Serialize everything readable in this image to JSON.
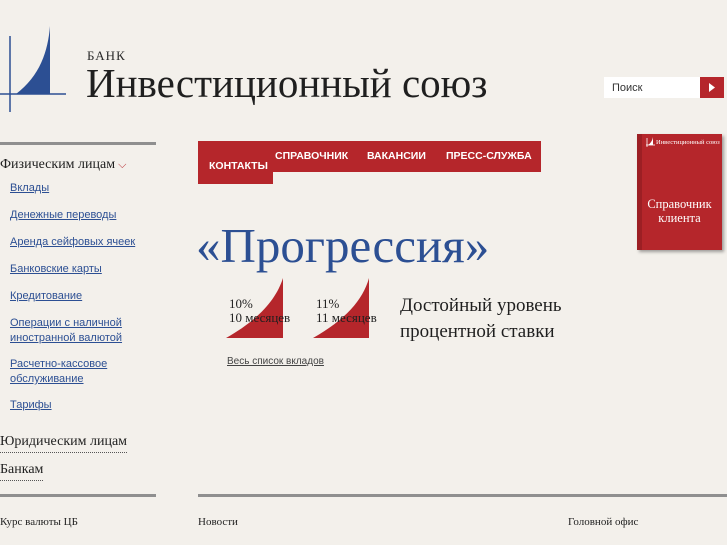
{
  "header": {
    "bank_label": "БАНК",
    "bank_name": "Инвестиционный союз",
    "logo_icon": "sail-logo-icon"
  },
  "search": {
    "placeholder": "Поиск",
    "value": "Поиск",
    "button_icon": "arrow-right-icon"
  },
  "sidebar": {
    "active_category": "Физическим лицам",
    "items": [
      {
        "label": "Вклады"
      },
      {
        "label": "Денежные переводы"
      },
      {
        "label": "Аренда сейфовых ячеек"
      },
      {
        "label": "Банковские карты"
      },
      {
        "label": "Кредитование"
      },
      {
        "label": "Операции с наличной иностранной валютой"
      },
      {
        "label": "Расчетно-кассовое обслуживание"
      },
      {
        "label": "Тарифы"
      }
    ],
    "other_categories": [
      {
        "label": "Юридическим лицам"
      },
      {
        "label": "Банкам"
      }
    ]
  },
  "topnav": {
    "items": [
      {
        "label": "КОНТАКТЫ"
      },
      {
        "label": "СПРАВОЧНИК"
      },
      {
        "label": "ВАКАНСИИ"
      },
      {
        "label": "ПРЕСС-СЛУЖБА"
      }
    ]
  },
  "promo": {
    "title": "«Прогрессия»",
    "rates": [
      {
        "percent": "10%",
        "term": "10 месяцев"
      },
      {
        "percent": "11%",
        "term": "11 месяцев"
      }
    ],
    "tagline_line1": "Достойный уровень",
    "tagline_line2": "процентной ставки",
    "link": "Весь список вкладов"
  },
  "book": {
    "brand": "Инвестиционный союз",
    "title_line1": "Справочник",
    "title_line2": "клиента"
  },
  "footer": {
    "headings": [
      {
        "label": "Курс валюты ЦБ"
      },
      {
        "label": "Новости"
      },
      {
        "label": "Головной офис"
      }
    ]
  },
  "colors": {
    "accent_red": "#b5262b",
    "link_blue": "#2c4f93",
    "background": "#f3f0eb"
  }
}
